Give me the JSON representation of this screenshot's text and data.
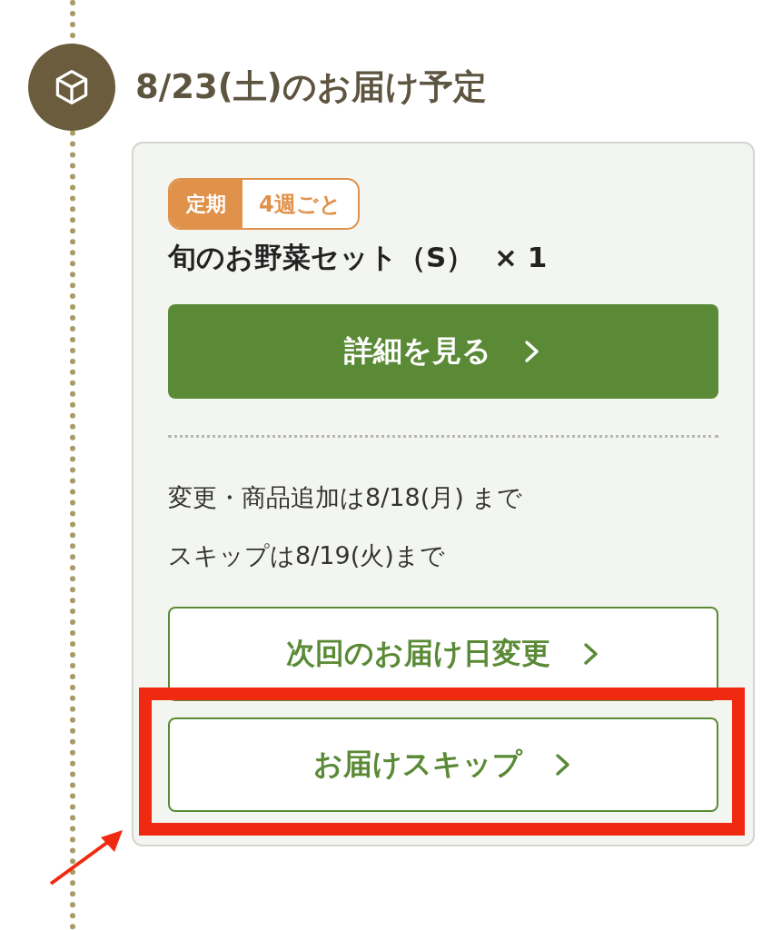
{
  "heading": "8/23(土)のお届け予定",
  "badge": {
    "label": "定期",
    "value": "4週ごと"
  },
  "product": "旬のお野菜セット（S）  × 1",
  "detail_button": "詳細を見る",
  "deadlines": [
    "変更・商品追加は8/18(月) まで",
    "スキップは8/19(火)まで"
  ],
  "action_button": {
    "label": "次回のお届け日変更"
  },
  "highlighted_button": {
    "label": "お届けスキップ"
  }
}
